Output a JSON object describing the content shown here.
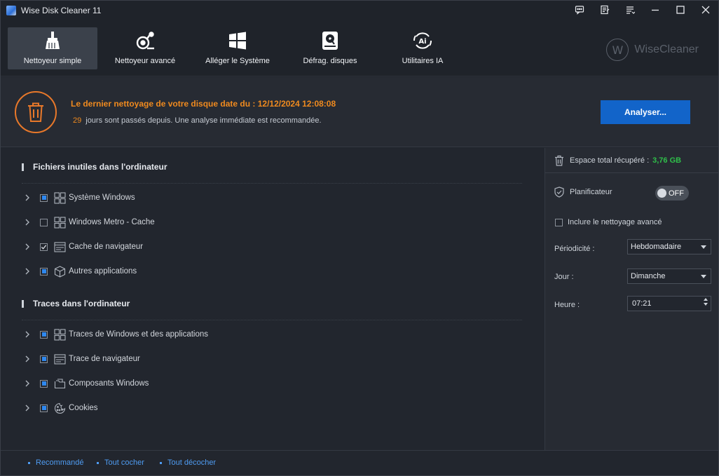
{
  "window": {
    "title": "Wise Disk Cleaner 11"
  },
  "window_controls": [
    "feedback-icon",
    "notes-icon",
    "menu-icon",
    "minimize-icon",
    "maximize-icon",
    "close-icon"
  ],
  "nav": {
    "tabs": [
      {
        "label": "Nettoyeur simple",
        "icon": "broom-icon",
        "active": true
      },
      {
        "label": "Nettoyeur avancé",
        "icon": "advanced-cleaner-icon",
        "active": false
      },
      {
        "label": "Alléger le Système",
        "icon": "windows-icon",
        "active": false
      },
      {
        "label": "Défrag. disques",
        "icon": "disk-icon",
        "active": false
      },
      {
        "label": "Utilitaires IA",
        "icon": "ai-icon",
        "active": false
      }
    ],
    "brand": {
      "logo": "W",
      "name": "WiseCleaner"
    }
  },
  "info": {
    "last_clean": "Le dernier nettoyage de votre disque date du : 12/12/2024 12:08:08",
    "days": "29",
    "days_text": "jours sont passés depuis. Une analyse immédiate est recommandée.",
    "analyze_button": "Analyser..."
  },
  "sections": [
    {
      "title": "Fichiers inutiles dans l'ordinateur",
      "items": [
        {
          "label": "Système Windows",
          "state": "partial",
          "icon": "windows-grid-icon"
        },
        {
          "label": "Windows Metro - Cache",
          "state": "unchecked",
          "icon": "windows-grid-icon"
        },
        {
          "label": "Cache de navigateur",
          "state": "checked",
          "icon": "browser-icon"
        },
        {
          "label": "Autres applications",
          "state": "partial",
          "icon": "box-icon"
        }
      ]
    },
    {
      "title": "Traces dans l'ordinateur",
      "items": [
        {
          "label": "Traces de Windows et des applications",
          "state": "partial",
          "icon": "windows-grid-icon"
        },
        {
          "label": "Trace de navigateur",
          "state": "partial",
          "icon": "browser-icon"
        },
        {
          "label": "Composants Windows",
          "state": "partial",
          "icon": "folder-icon"
        },
        {
          "label": "Cookies",
          "state": "partial",
          "icon": "cookie-icon"
        }
      ]
    }
  ],
  "right_panel": {
    "space_label": "Espace total récupéré :",
    "space_value": "3,76 GB",
    "scheduler_label": "Planificateur",
    "toggle_label": "OFF",
    "include_advanced": "Inclure le nettoyage avancé",
    "periodicity_label": "Périodicité :",
    "periodicity_value": "Hebdomadaire",
    "day_label": "Jour :",
    "day_value": "Dimanche",
    "time_label": "Heure :",
    "time_value": "07:21"
  },
  "footer": {
    "links": [
      "Recommandé",
      "Tout cocher",
      "Tout décocher"
    ]
  },
  "colors": {
    "accent_orange": "#ef8a1f",
    "accent_blue": "#1264c9",
    "success_green": "#2fbf4a",
    "link_blue": "#4f9cf2"
  }
}
